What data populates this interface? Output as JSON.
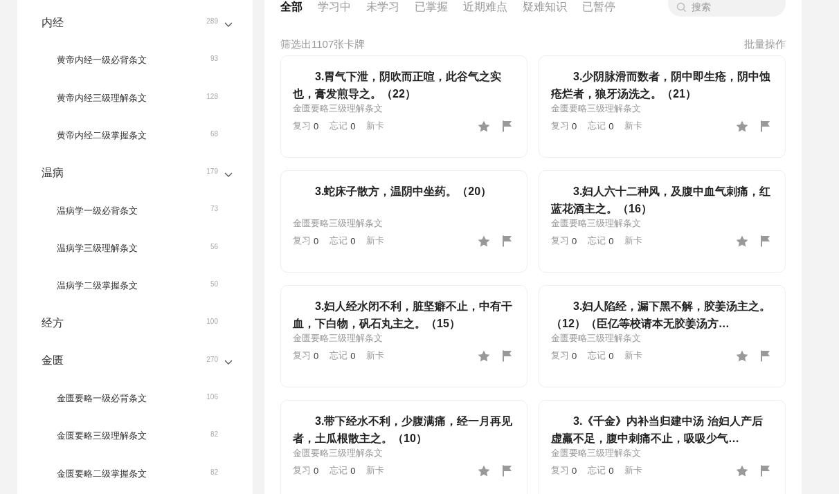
{
  "sidebar": {
    "groups": [
      {
        "label": "内经",
        "count": "289",
        "expanded": true,
        "children": [
          {
            "label": "黄帝内经一级必背条文",
            "count": "93"
          },
          {
            "label": "黄帝内经三级理解条文",
            "count": "128"
          },
          {
            "label": "黄帝内经二级掌握条文",
            "count": "68"
          }
        ]
      },
      {
        "label": "温病",
        "count": "179",
        "expanded": true,
        "children": [
          {
            "label": "温病学一级必背条文",
            "count": "73"
          },
          {
            "label": "温病学三级理解条文",
            "count": "56"
          },
          {
            "label": "温病学二级掌握条文",
            "count": "50"
          }
        ]
      },
      {
        "label": "经方",
        "count": "100"
      },
      {
        "label": "金匮",
        "count": "270",
        "expanded": true,
        "children": [
          {
            "label": "金匮要略一级必背条文",
            "count": "106"
          },
          {
            "label": "金匮要略三级理解条文",
            "count": "82"
          },
          {
            "label": "金匮要略二级掌握条文",
            "count": "82"
          }
        ]
      }
    ]
  },
  "tabs": [
    {
      "label": "全部",
      "selected": true
    },
    {
      "label": "学习中",
      "selected": false
    },
    {
      "label": "未学习",
      "selected": false
    },
    {
      "label": "已掌握",
      "selected": false
    },
    {
      "label": "近期难点",
      "selected": false
    },
    {
      "label": "疑难知识",
      "selected": false
    },
    {
      "label": "已暂停",
      "selected": false
    }
  ],
  "search": {
    "placeholder": "搜索"
  },
  "filter_summary": "筛选出1107张卡牌",
  "batch_action": "批量操作",
  "cards": [
    {
      "title": "3.胃气下泄，阴吹而正喧，此谷气之实也，膏发煎导之。（22）",
      "source": "金匮要略三级理解条文",
      "stats": [
        {
          "label": "复习",
          "value": "0"
        },
        {
          "label": "忘记",
          "value": "0"
        }
      ],
      "status": "新卡"
    },
    {
      "title": "3.少阴脉滑而数者，阴中即生疮，阴中蚀疮烂者，狼牙汤洗之。（21）",
      "source": "金匮要略三级理解条文",
      "stats": [
        {
          "label": "复习",
          "value": "0"
        },
        {
          "label": "忘记",
          "value": "0"
        }
      ],
      "status": "新卡"
    },
    {
      "title": "3.蛇床子散方，温阴中坐药。（20）",
      "source": "金匮要略三级理解条文",
      "stats": [
        {
          "label": "复习",
          "value": "0"
        },
        {
          "label": "忘记",
          "value": "0"
        }
      ],
      "status": "新卡"
    },
    {
      "title": "3.妇人六十二种风，及腹中血气刺痛，红蓝花酒主之。（16）",
      "source": "金匮要略三级理解条文",
      "stats": [
        {
          "label": "复习",
          "value": "0"
        },
        {
          "label": "忘记",
          "value": "0"
        }
      ],
      "status": "新卡"
    },
    {
      "title": "3.妇人经水闭不利，脏坚癖不止，中有干血，下白物，矾石丸主之。（15）",
      "source": "金匮要略三级理解条文",
      "stats": [
        {
          "label": "复习",
          "value": "0"
        },
        {
          "label": "忘记",
          "value": "0"
        }
      ],
      "status": "新卡"
    },
    {
      "title": "3.妇人陷经，漏下黑不解，胶姜汤主之。（12）（臣亿等校请本无胶姜汤方…",
      "source": "金匮要略三级理解条文",
      "stats": [
        {
          "label": "复习",
          "value": "0"
        },
        {
          "label": "忘记",
          "value": "0"
        }
      ],
      "status": "新卡"
    },
    {
      "title": "3.带下经水不利，少腹满痛，经一月再见者，土瓜根散主之。（10）",
      "source": "金匮要略三级理解条文",
      "stats": [
        {
          "label": "复习",
          "value": "0"
        },
        {
          "label": "忘记",
          "value": "0"
        }
      ],
      "status": "新卡"
    },
    {
      "title": "3.《千金》内补当归建中汤 治妇人产后虚羸不足，腹中刺痛不止，吸吸少气…",
      "source": "金匮要略三级理解条文",
      "stats": [
        {
          "label": "复习",
          "value": "0"
        },
        {
          "label": "忘记",
          "value": "0"
        }
      ],
      "status": "新卡"
    }
  ]
}
